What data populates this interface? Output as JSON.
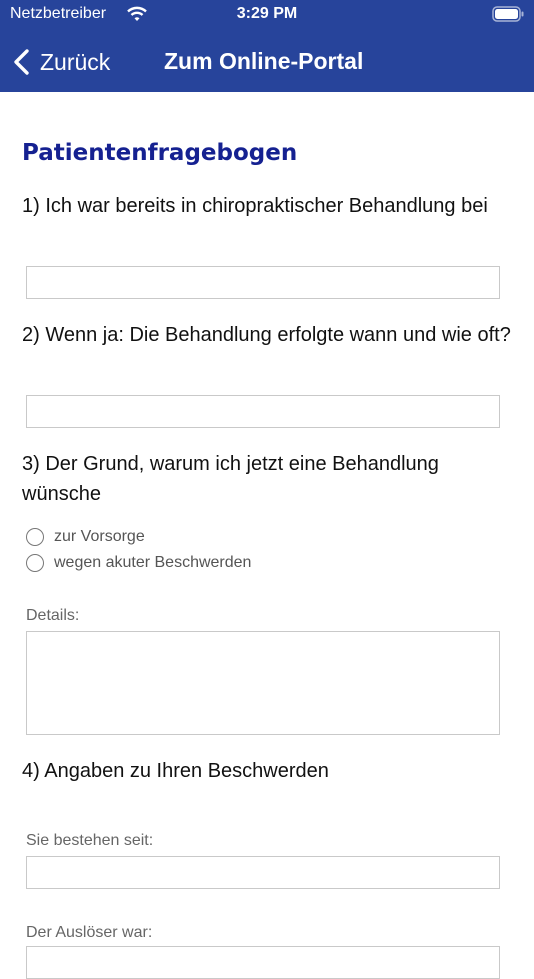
{
  "status_bar": {
    "carrier": "Netzbetreiber",
    "time": "3:29 PM"
  },
  "nav": {
    "back_label": "Zurück",
    "title": "Zum Online-Portal"
  },
  "form": {
    "title": "Patientenfragebogen",
    "q1": "1) Ich war bereits in chiropraktischer Behandlung bei",
    "q2": "2) Wenn ja: Die Behandlung erfolgte wann und wie oft?",
    "q3": "3) Der Grund, warum ich jetzt eine Behandlung wünsche",
    "q3_options": [
      "zur Vorsorge",
      "wegen akuter Beschwerden"
    ],
    "details_label": "Details:",
    "q4": "4) Angaben zu Ihren Beschwerden",
    "since_label": "Sie bestehen seit:",
    "trigger_label": "Der Auslöser war:"
  },
  "colors": {
    "header_bg": "#27449b",
    "title_color": "#152191"
  }
}
